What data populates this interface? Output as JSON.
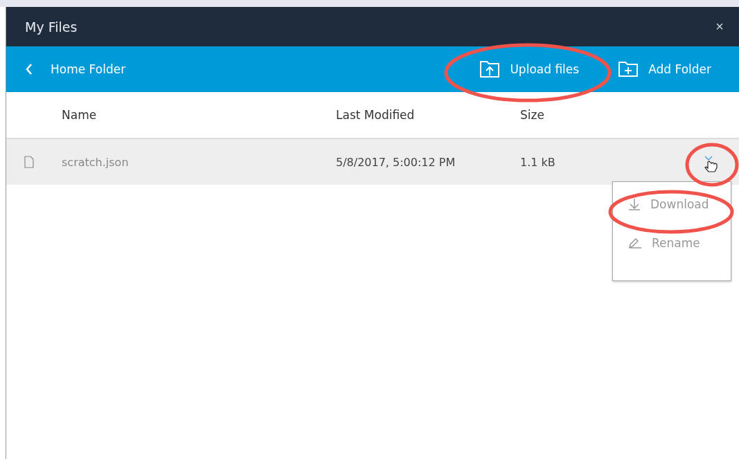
{
  "window": {
    "title": "My Files",
    "close": "×"
  },
  "toolbar": {
    "back_label": "Home Folder",
    "actions": [
      {
        "kind": "upload",
        "label": "Upload files",
        "highlighted": true
      },
      {
        "kind": "folder",
        "label": "Add Folder",
        "highlighted": false
      }
    ]
  },
  "table": {
    "columns": [
      "Name",
      "Last Modified",
      "Size"
    ],
    "rows": [
      {
        "name": "scratch.json",
        "modified": "5/8/2017, 5:00:12 PM",
        "size": "1.1 kB",
        "selected": true,
        "menu_toggle_highlighted": true
      }
    ]
  },
  "row_menu": {
    "expanded": true,
    "items": [
      {
        "kind": "download",
        "label": "Download",
        "highlighted": true
      },
      {
        "kind": "rename",
        "label": "Rename",
        "highlighted": false
      }
    ]
  }
}
